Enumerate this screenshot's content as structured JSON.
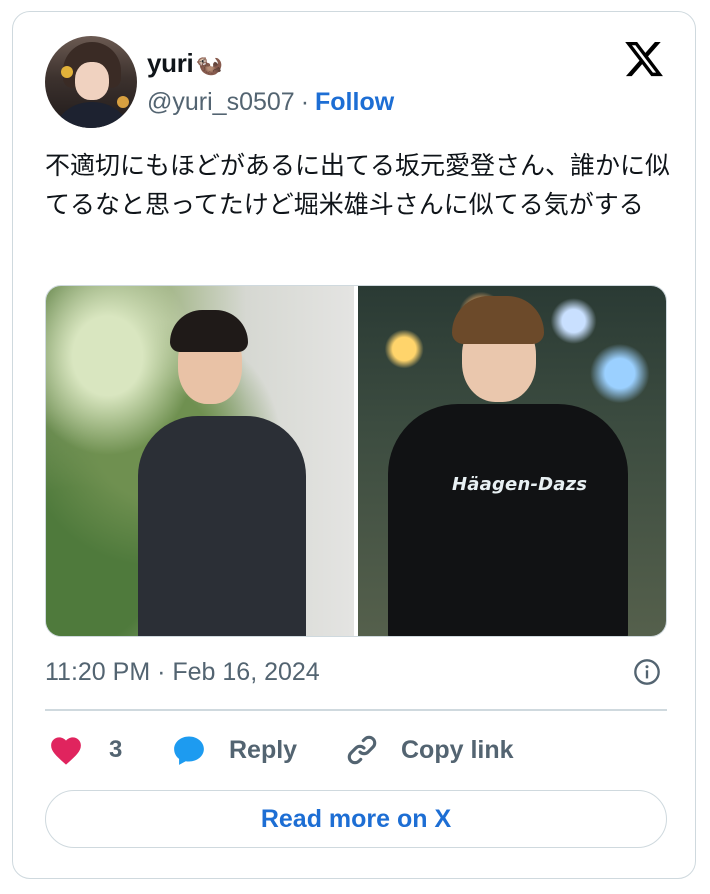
{
  "author": {
    "display_name": "yuri",
    "name_emoji": "🦦",
    "handle": "@yuri_s0507",
    "separator": "·",
    "follow_label": "Follow"
  },
  "tweet": {
    "text": "不適切にもほどがあるに出てる坂元愛登さん、誰かに似てるなと思ってたけど堀米雄斗さんに似てる気がする",
    "media": {
      "shirt_text": "Häagen-Dazs"
    },
    "timestamp": "11:20 PM · Feb 16, 2024"
  },
  "actions": {
    "like_count": "3",
    "reply_label": "Reply",
    "copy_link_label": "Copy link"
  },
  "read_more_label": "Read more on X",
  "colors": {
    "accent": "#1d6ed4",
    "like": "#e0245e",
    "border": "#cfd9de",
    "muted": "#536471"
  }
}
